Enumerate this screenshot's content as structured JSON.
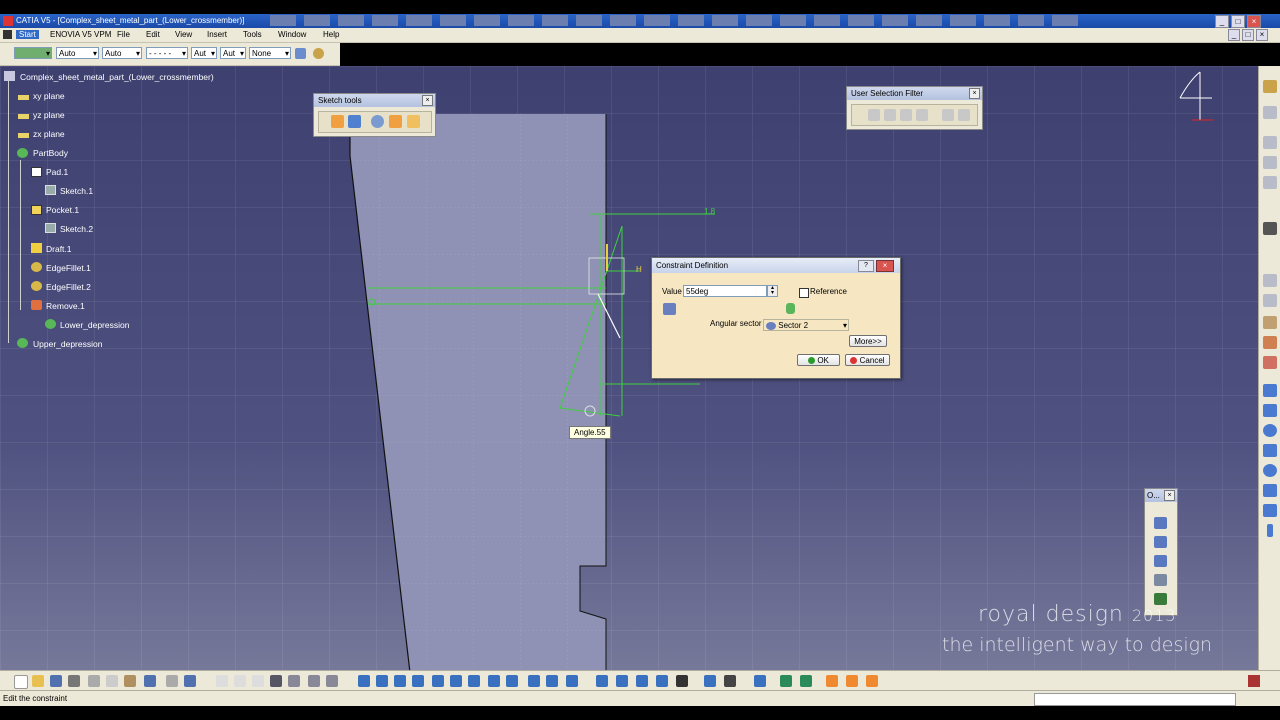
{
  "window": {
    "title": "CATIA V5 - [Complex_sheet_metal_part_(Lower_crossmember)]"
  },
  "menu": {
    "start": "Start",
    "items": [
      "ENOVIA V5 VPM",
      "File",
      "Edit",
      "View",
      "Insert",
      "Tools",
      "Window",
      "Help"
    ]
  },
  "graphic_properties": {
    "linetype": "Auto",
    "thickness": "Auto",
    "dash": "- - - - -",
    "layer_a": "Aut",
    "layer_b": "Aut",
    "layer": "None"
  },
  "tree": {
    "root": "Complex_sheet_metal_part_(Lower_crossmember)",
    "nodes": [
      "xy plane",
      "yz plane",
      "zx plane",
      "PartBody",
      "Pad.1",
      "Sketch.1",
      "Pocket.1",
      "Sketch.2",
      "Draft.1",
      "EdgeFillet.1",
      "EdgeFillet.2",
      "Remove.1",
      "Lower_depression",
      "Upper_depression"
    ]
  },
  "sketch_tools": {
    "title": "Sketch tools"
  },
  "user_selection_filter": {
    "title": "User Selection Filter"
  },
  "constraint_dialog": {
    "title": "Constraint Definition",
    "value_label": "Value",
    "value": "55deg",
    "reference_label": "Reference",
    "reference_checked": false,
    "angular_sector_label": "Angular sector",
    "angular_sector_value": "Sector 2",
    "more_label": "More>>",
    "ok_label": "OK",
    "cancel_label": "Cancel"
  },
  "canvas": {
    "angle_tag": "Angle.55",
    "dim_top": "1.8",
    "dim_h": "H"
  },
  "profile_toolbar": {
    "title": "O..."
  },
  "watermark": {
    "line1": "royal design",
    "year": "2013",
    "line2": "the intelligent way to design"
  },
  "status": {
    "message": "Edit the constraint"
  },
  "colors": {
    "viewport_bg": "#4a4c78",
    "dialog_bg": "#f6e7c2",
    "sketch_green": "#3fcf3f"
  }
}
